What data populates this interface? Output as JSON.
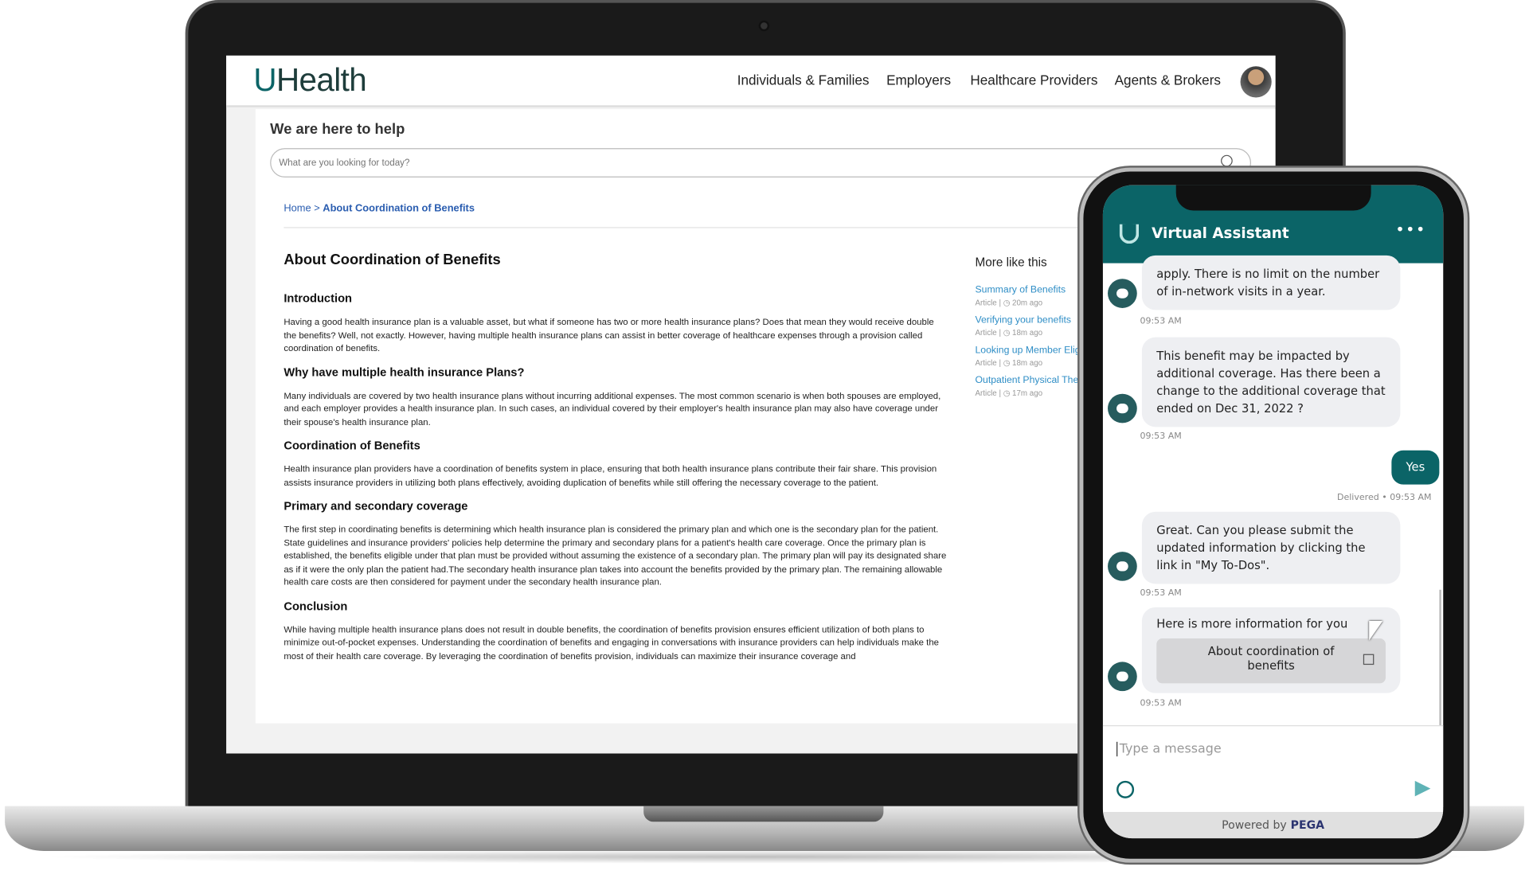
{
  "site": {
    "logo": "UHealth",
    "logo_mark": "U",
    "logo_text": "Health",
    "nav": [
      "Individuals & Families",
      "Employers",
      "Healthcare Providers",
      "Agents & Brokers"
    ]
  },
  "help": {
    "heading": "We are here to help",
    "search_placeholder": "What are you looking for today?"
  },
  "breadcrumb": {
    "home": "Home >",
    "current": "About Coordination of Benefits"
  },
  "article": {
    "title": "About Coordination of Benefits",
    "sections": [
      {
        "heading": "Introduction",
        "body": "Having a good health insurance plan is a valuable asset, but what if someone has two or more health insurance plans? Does that mean they would receive double the benefits? Well, not exactly. However, having multiple health insurance plans can assist in better coverage of healthcare expenses through a provision called coordination of benefits."
      },
      {
        "heading": "Why have multiple health insurance Plans?",
        "body": "Many individuals are covered by two health insurance plans without incurring additional expenses. The most common scenario is when both spouses are employed, and each employer provides a health insurance plan. In such cases, an individual covered by their employer's health insurance plan may also have coverage under their spouse's health insurance plan."
      },
      {
        "heading": "Coordination of Benefits",
        "body": "Health insurance plan providers have a coordination of benefits system in place, ensuring that both health insurance plans contribute their fair share. This provision assists insurance providers in utilizing both plans effectively, avoiding duplication of benefits while still offering the necessary coverage to the patient."
      },
      {
        "heading": "Primary and secondary coverage",
        "body": "The first step in coordinating benefits is determining which health insurance plan is considered the primary plan and which one is the secondary plan for the patient. State guidelines and insurance providers' policies help determine the primary and secondary plans for a patient's health care coverage. Once the primary plan is established, the benefits eligible under that plan must be provided without assuming the existence of a secondary plan. The primary plan will pay its designated share as if it were the only plan the patient had.The secondary health insurance plan takes into account the benefits provided by the primary plan. The remaining allowable health care costs are then considered for payment under the secondary health insurance plan."
      },
      {
        "heading": "Conclusion",
        "body": "While having multiple health insurance plans does not result in double benefits, the coordination of benefits provision ensures efficient utilization of both plans to minimize out-of-pocket expenses. Understanding the coordination of benefits and engaging in conversations with insurance providers can help individuals make the most of their health care coverage. By leveraging the coordination of benefits provision, individuals can maximize their insurance coverage and"
      }
    ]
  },
  "more": {
    "heading": "More like this",
    "items": [
      {
        "title": "Summary of Benefits",
        "type": "Article",
        "age": "20m ago"
      },
      {
        "title": "Verifying your benefits",
        "type": "Article",
        "age": "18m ago"
      },
      {
        "title": "Looking up Member Eligibility",
        "type": "Article",
        "age": "18m ago"
      },
      {
        "title": "Outpatient Physical Therapy",
        "type": "Article",
        "age": "17m ago"
      }
    ]
  },
  "chat": {
    "title": "Virtual Assistant",
    "menu": "•••",
    "messages": [
      {
        "text": "apply. There is no limit on the number of in-network visits in a year.",
        "time": "09:53 AM"
      },
      {
        "text": "This benefit may be impacted by additional coverage. Has there been a change to the additional coverage that ended on Dec 31, 2022 ?",
        "time": "09:53 AM"
      },
      {
        "text": "Great. Can you please submit the updated information by clicking the link in \"My To-Dos\".",
        "time": "09:53 AM"
      },
      {
        "text": "Here is more information for you",
        "link": "About coordination of benefits",
        "time": "09:53 AM"
      }
    ],
    "user_reply": "Yes",
    "delivered": "Delivered • 09:53 AM",
    "input_placeholder": "Type a message",
    "powered_by": "Powered by",
    "brand": "PEGA",
    "colors": {
      "teal": "#0b6467",
      "bubble": "#eeeff2"
    }
  }
}
